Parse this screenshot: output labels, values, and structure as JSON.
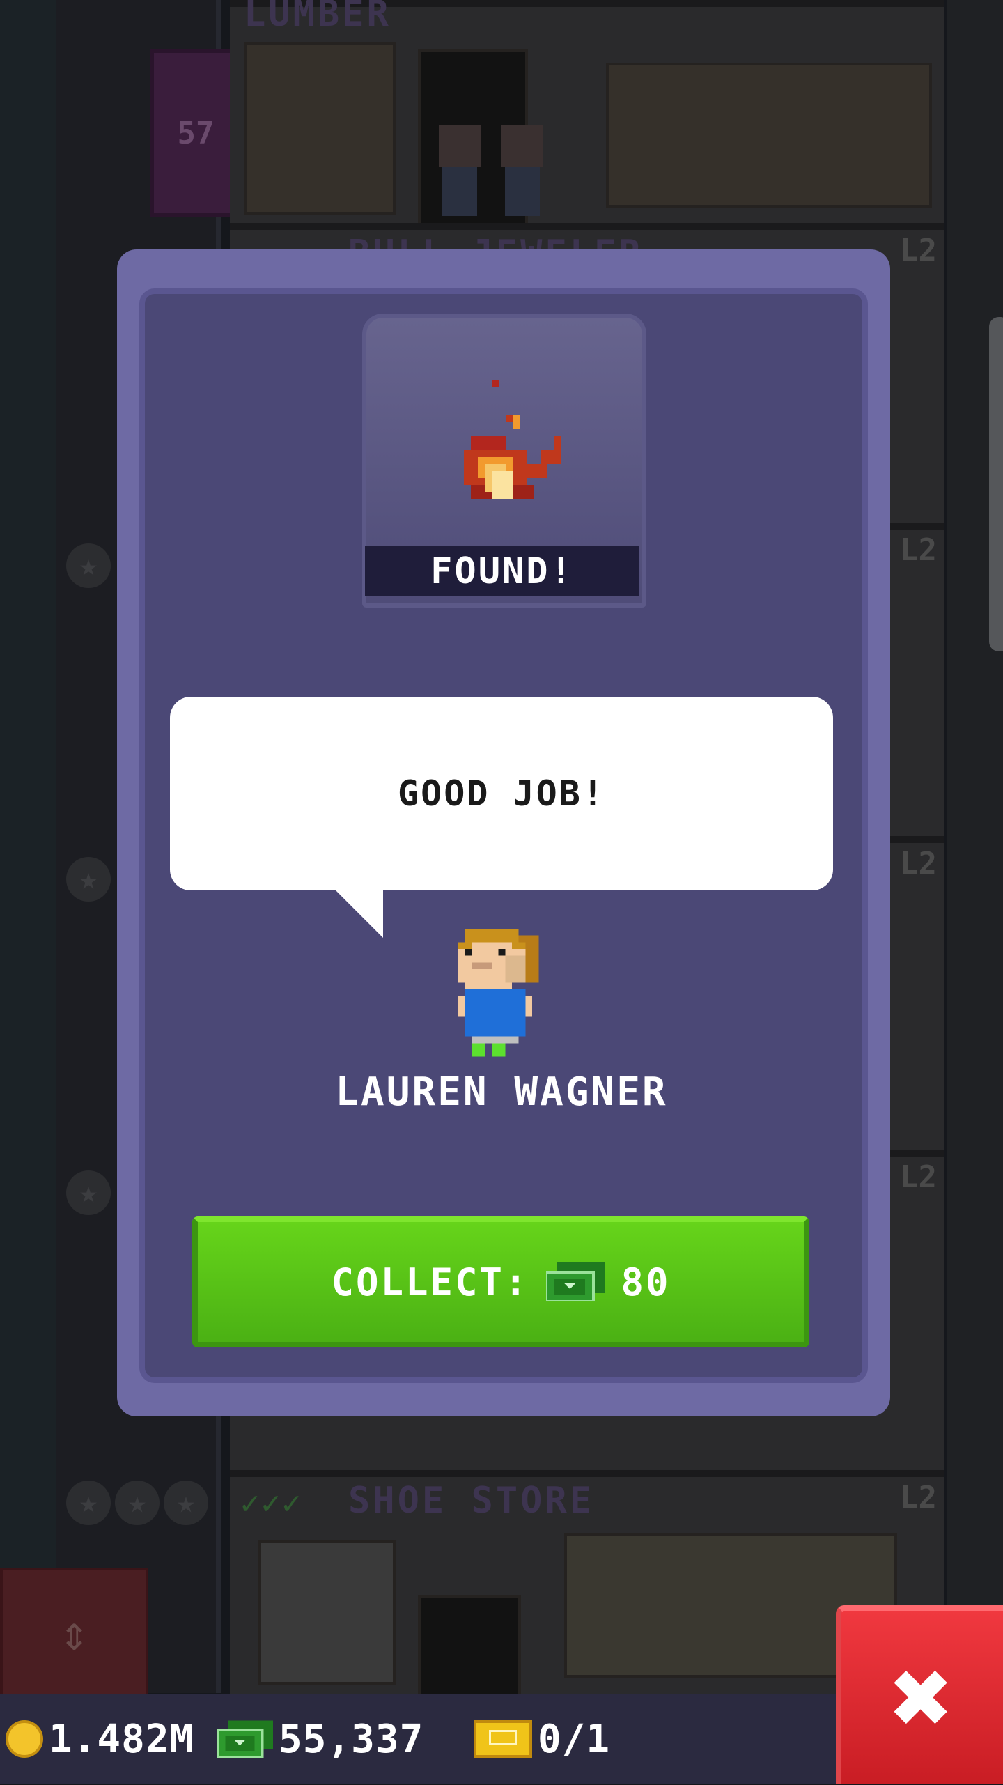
{
  "background": {
    "elevator_floor_number": "57",
    "floors": [
      {
        "title": "LUMBER",
        "level": ""
      },
      {
        "title": "BULL JEWELER",
        "level": "L2"
      },
      {
        "title": "SHOE STORE",
        "level": "L2"
      }
    ],
    "side_levels": [
      "L2",
      "L2",
      "L2",
      "L2"
    ],
    "checkmarks": "✓✓✓"
  },
  "dialog": {
    "found_label": "FOUND!",
    "speech_text": "GOOD JOB!",
    "npc_name": "LAUREN WAGNER",
    "collect_label": "COLLECT:",
    "collect_amount": "80",
    "found_item_icon": "flame-item-icon",
    "collect_currency_icon": "bux-icon"
  },
  "statusbar": {
    "coins": "1.482M",
    "bux": "55,337",
    "tickets": "0/1",
    "coin_icon": "coin-icon",
    "bux_icon": "bux-icon",
    "ticket_icon": "golden-ticket-icon"
  },
  "close_icon": "close-icon",
  "colors": {
    "dialog_frame": "#6e6aa4",
    "dialog_inner": "#4b4876",
    "collect_green": "#58c617",
    "close_red": "#e0282f",
    "statusbar": "#2b2a40"
  }
}
